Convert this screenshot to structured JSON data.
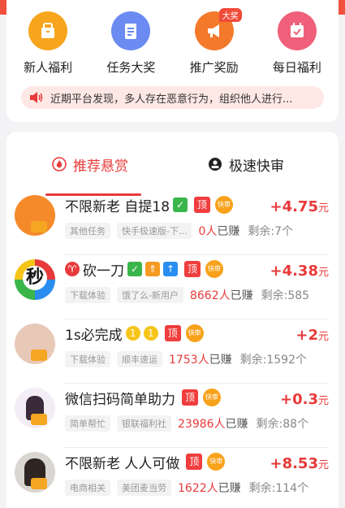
{
  "quick_entries": [
    {
      "label": "新人福利",
      "icon": "gift-bag-icon",
      "color": "#f6a51c"
    },
    {
      "label": "任务大奖",
      "icon": "clipboard-icon",
      "color": "#6b8bf2"
    },
    {
      "label": "推广奖励",
      "icon": "megaphone-icon",
      "color": "#f5792b",
      "badge": "大奖"
    },
    {
      "label": "每日福利",
      "icon": "calendar-icon",
      "color": "#f0607a"
    }
  ],
  "notice": {
    "text": "近期平台发现，多人存在恶意行为，组织他人进行..."
  },
  "tabs": {
    "recommended": "推荐悬赏",
    "fast_review": "极速快审"
  },
  "tags": {
    "top": "顶",
    "fast": "快审"
  },
  "tasks": [
    {
      "title": "不限新老 自提18",
      "chips": [
        "其他任务",
        "快手极速版-下..."
      ],
      "earned_num": "0人",
      "earned_suffix": "已赚",
      "remain": "剩余:7个",
      "reward": "+4.75",
      "unit": "元"
    },
    {
      "title": "砍一刀",
      "chips": [
        "下载体验",
        "饿了么-新用户"
      ],
      "earned_num": "8662人",
      "earned_suffix": "已赚",
      "remain": "剩余:585",
      "reward": "+4.38",
      "unit": "元"
    },
    {
      "title": "1s必完成",
      "chips": [
        "下载体验",
        "顺丰速运"
      ],
      "earned_num": "1753人",
      "earned_suffix": "已赚",
      "remain": "剩余:1592个",
      "reward": "+2",
      "unit": "元"
    },
    {
      "title": "微信扫码简单助力",
      "chips": [
        "简单帮忙",
        "银联福利社"
      ],
      "earned_num": "23986人",
      "earned_suffix": "已赚",
      "remain": "剩余:88个",
      "reward": "+0.3",
      "unit": "元"
    },
    {
      "title": "不限新老 人人可做",
      "chips": [
        "电商相关",
        "美团麦当劳"
      ],
      "earned_num": "1622人",
      "earned_suffix": "已赚",
      "remain": "剩余:114个",
      "reward": "+8.53",
      "unit": "元"
    }
  ],
  "avatar_marks": {
    "miao": "秒"
  },
  "colors": {
    "accent": "#e83a3a",
    "check": "#3ab54a",
    "up": "#f59a23",
    "up2": "#2a8ef0"
  }
}
